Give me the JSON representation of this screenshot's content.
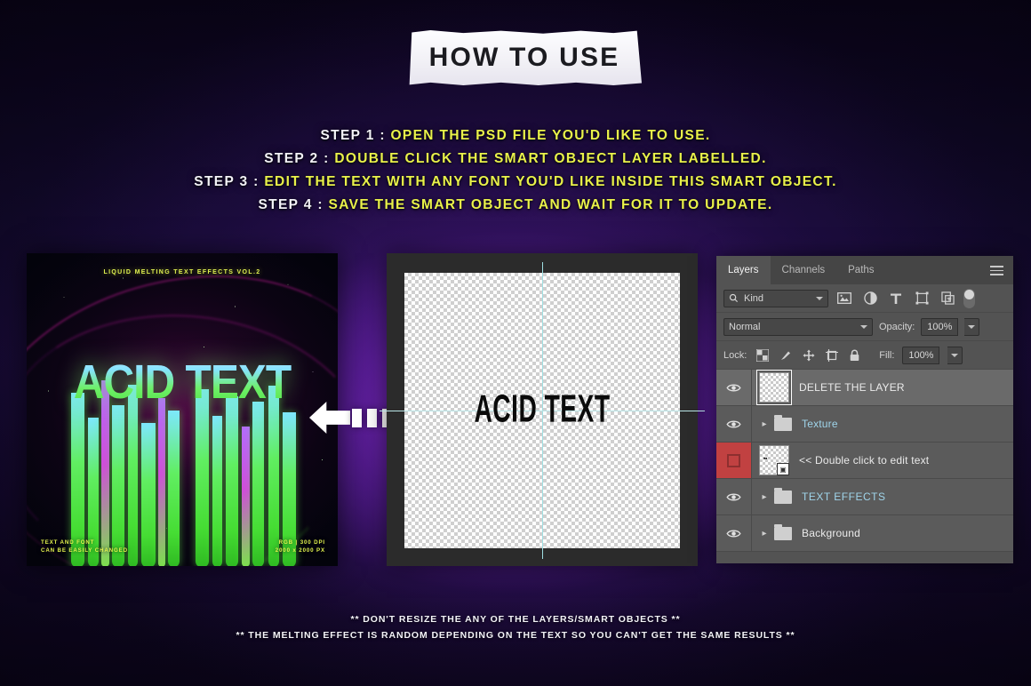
{
  "title": {
    "text": "HOW TO USE"
  },
  "steps": [
    {
      "label": "STEP 1 :",
      "text": "OPEN THE PSD FILE YOU'D LIKE TO USE."
    },
    {
      "label": "STEP 2 :",
      "text": "DOUBLE CLICK THE SMART OBJECT LAYER LABELLED."
    },
    {
      "label": "STEP 3 :",
      "text": "EDIT THE TEXT WITH ANY FONT YOU'D LIKE INSIDE THIS SMART OBJECT."
    },
    {
      "label": "STEP 4 :",
      "text": "SAVE THE SMART OBJECT AND WAIT FOR IT TO UPDATE."
    }
  ],
  "poster": {
    "header": "LIQUID MELTING TEXT EFFECTS VOL.2",
    "artwork_text": "ACID TEXT",
    "footer_left_line1": "TEXT AND FONT",
    "footer_left_line2": "CAN BE EASILY CHANGED",
    "footer_right_line1": "RGB  |  300 DPI",
    "footer_right_line2": "2000 x 2000 PX"
  },
  "smart_object": {
    "canvas_text": "ACID TEXT"
  },
  "photoshop": {
    "tabs": [
      {
        "label": "Layers",
        "active": true
      },
      {
        "label": "Channels",
        "active": false
      },
      {
        "label": "Paths",
        "active": false
      }
    ],
    "filter": {
      "kind_label": "Kind",
      "icons": [
        "pixel-layer-filter-icon",
        "adjustment-layer-filter-icon",
        "type-layer-filter-icon",
        "shape-layer-filter-icon",
        "smart-object-filter-icon",
        "filter-toggle-switch"
      ]
    },
    "blend": {
      "mode": "Normal",
      "opacity_label": "Opacity:",
      "opacity_value": "100%"
    },
    "lock": {
      "label": "Lock:",
      "icons": [
        "lock-transparent-pixels-icon",
        "lock-image-pixels-icon",
        "lock-position-icon",
        "lock-artboard-nesting-icon",
        "lock-all-icon"
      ],
      "fill_label": "Fill:",
      "fill_value": "100%"
    },
    "layers": [
      {
        "name": "DELETE THE LAYER",
        "type": "pixel",
        "visible": true,
        "selected": true,
        "expandable": false,
        "name_color": "white",
        "eye_red": false
      },
      {
        "name": "Texture",
        "type": "group",
        "visible": true,
        "selected": false,
        "expandable": true,
        "name_color": "blue",
        "eye_red": false
      },
      {
        "name": "<< Double click to edit text",
        "type": "smart-object",
        "visible": false,
        "selected": false,
        "expandable": false,
        "name_color": "white",
        "eye_red": true
      },
      {
        "name": "TEXT EFFECTS",
        "type": "group",
        "visible": true,
        "selected": false,
        "expandable": true,
        "name_color": "blue",
        "eye_red": false
      },
      {
        "name": "Background",
        "type": "group",
        "visible": true,
        "selected": false,
        "expandable": true,
        "name_color": "white",
        "eye_red": false
      }
    ]
  },
  "footer": {
    "line1": "** DON'T RESIZE THE ANY OF THE LAYERS/SMART OBJECTS **",
    "line2": "** THE MELTING EFFECT IS RANDOM DEPENDING ON THE TEXT SO YOU CAN'T GET THE SAME RESULTS **"
  },
  "colors": {
    "accent_yellow": "#e9f24a",
    "purple_glow": "#7a2bc4",
    "panel_gray": "#535353",
    "red_flag": "#c14141"
  }
}
